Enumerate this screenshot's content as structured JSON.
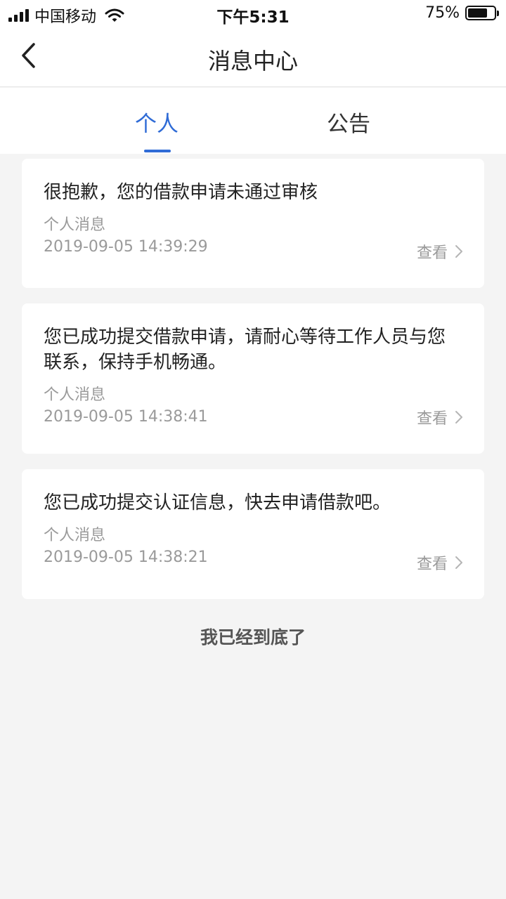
{
  "status_bar": {
    "carrier": "中国移动",
    "time": "下午5:31",
    "battery": "75%",
    "battery_level": 0.75
  },
  "nav": {
    "title": "消息中心",
    "back_icon": "chevron-left-icon"
  },
  "tabs": [
    {
      "label": "个人",
      "active": true
    },
    {
      "label": "公告",
      "active": false
    }
  ],
  "messages": [
    {
      "text": "很抱歉，您的借款申请未通过审核",
      "category": "个人消息",
      "time": "2019-09-05 14:39:29",
      "action": "查看"
    },
    {
      "text": "您已成功提交借款申请，请耐心等待工作人员与您联系，保持手机畅通。",
      "category": "个人消息",
      "time": "2019-09-05 14:38:41",
      "action": "查看"
    },
    {
      "text": "您已成功提交认证信息，快去申请借款吧。",
      "category": "个人消息",
      "time": "2019-09-05 14:38:21",
      "action": "查看"
    }
  ],
  "footer": {
    "end_text": "我已经到底了"
  },
  "colors": {
    "accent": "#2f6bd6",
    "background": "#f4f4f4",
    "muted_text": "#9a9a9a"
  }
}
